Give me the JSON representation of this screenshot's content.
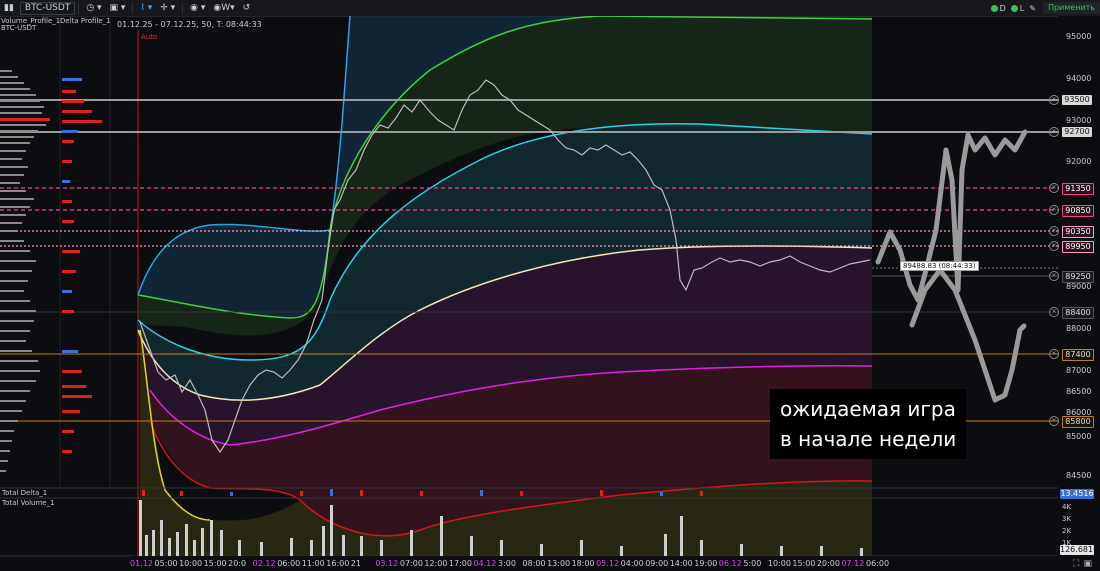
{
  "toolbar": {
    "symbol": "BTC-USDT",
    "interval": "W",
    "apply_label": "Применить",
    "indicator_d": "D",
    "indicator_l": "L"
  },
  "header": {
    "range_info": "01.12.25 - 07.12.25, 50, T: 08:44:33",
    "volume_profile_label": "Volume_Profile_1",
    "delta_profile_label": "Delta Profile_1",
    "symbol_label": "BTC-USDT",
    "auto_label": "Auto"
  },
  "subpanels": {
    "delta_label": "Total Delta_1",
    "volume_label": "Total Volume_1",
    "delta_value": "13.4516",
    "volume_value": "126.6816",
    "volume_ticks": [
      "4K",
      "3K",
      "2K",
      "1K"
    ]
  },
  "price_axis": {
    "ticks": [
      "95000",
      "94000",
      "93000",
      "92000",
      "90000",
      "89000",
      "88000",
      "87000",
      "86500",
      "86000",
      "85000",
      "84500"
    ],
    "levels": [
      {
        "label": "93500",
        "style": "grey"
      },
      {
        "label": "92700",
        "style": "grey"
      },
      {
        "label": "91350",
        "style": "pink"
      },
      {
        "label": "90850",
        "style": "pink"
      },
      {
        "label": "90350",
        "style": "pink"
      },
      {
        "label": "89950",
        "style": "pink"
      },
      {
        "label": "89250",
        "style": "dark"
      },
      {
        "label": "88400",
        "style": "dark"
      },
      {
        "label": "87400",
        "style": "orange"
      },
      {
        "label": "85800",
        "style": "orange"
      }
    ]
  },
  "crosshair_label": "89488.83 (08:44:33)",
  "time_axis": [
    {
      "label": "01.12",
      "date": true
    },
    {
      "label": "05:00",
      "date": false
    },
    {
      "label": "10:00",
      "date": false
    },
    {
      "label": "15:00",
      "date": false
    },
    {
      "label": "20:0",
      "date": false
    },
    {
      "label": "02.12",
      "date": true
    },
    {
      "label": "06:00",
      "date": false
    },
    {
      "label": "11:00",
      "date": false
    },
    {
      "label": "16:00",
      "date": false
    },
    {
      "label": "21",
      "date": false
    },
    {
      "label": "03.12",
      "date": true
    },
    {
      "label": "07:00",
      "date": false
    },
    {
      "label": "12:00",
      "date": false
    },
    {
      "label": "17:00",
      "date": false
    },
    {
      "label": "04.12",
      "date": true
    },
    {
      "label": "3:00",
      "date": false
    },
    {
      "label": "08:00",
      "date": false
    },
    {
      "label": "13:00",
      "date": false
    },
    {
      "label": "18:00",
      "date": false
    },
    {
      "label": "05.12",
      "date": true
    },
    {
      "label": "04:00",
      "date": false
    },
    {
      "label": "09:00",
      "date": false
    },
    {
      "label": "14:00",
      "date": false
    },
    {
      "label": "19:00",
      "date": false
    },
    {
      "label": "06.12",
      "date": true
    },
    {
      "label": "5:00",
      "date": false
    },
    {
      "label": "10:00",
      "date": false
    },
    {
      "label": "15:00",
      "date": false
    },
    {
      "label": "20:00",
      "date": false
    },
    {
      "label": "07.12",
      "date": true
    },
    {
      "label": "06:00",
      "date": false
    }
  ],
  "annotation": {
    "line1": "ожидаемая игра",
    "line2": "в начале недели"
  },
  "colors": {
    "grey_level": "#9a9a9a",
    "pink_level": "#ff3b8a",
    "orange_level": "#c77a1a",
    "blue_band": "#29a3e6",
    "cyan_band": "#2ad0e6",
    "green_band": "#3fcf3f",
    "cream_band": "#f1e6b8",
    "magenta_band": "#e022e0",
    "red_band": "#cc1a1a",
    "yellow_band": "#e6d21a"
  },
  "chart_data": {
    "type": "line",
    "title": "",
    "ylim": [
      84000,
      95500
    ],
    "levels": [
      93500,
      92700,
      91350,
      90850,
      90350,
      89950,
      89250,
      88400,
      87400,
      85800
    ],
    "last_price": 89488.83,
    "series": [
      {
        "x": [
          "01.12 00:00",
          "01.12 06:00",
          "01.12 12:00",
          "01.12 18:00",
          "02.12 06:00",
          "02.12 18:00",
          "03.12 00:00",
          "03.12 06:00",
          "03.12 12:00",
          "03.12 18:00",
          "04.12 06:00",
          "04.12 18:00",
          "05.12 06:00",
          "05.12 18:00",
          "06.12 06:00",
          "06.12 18:00",
          "07.12 06:00"
        ],
        "values": [
          88100,
          86600,
          86100,
          85800,
          86600,
          86900,
          88300,
          91400,
          92300,
          92700,
          93200,
          92600,
          92000,
          90500,
          89300,
          89500,
          89300
        ]
      }
    ]
  }
}
